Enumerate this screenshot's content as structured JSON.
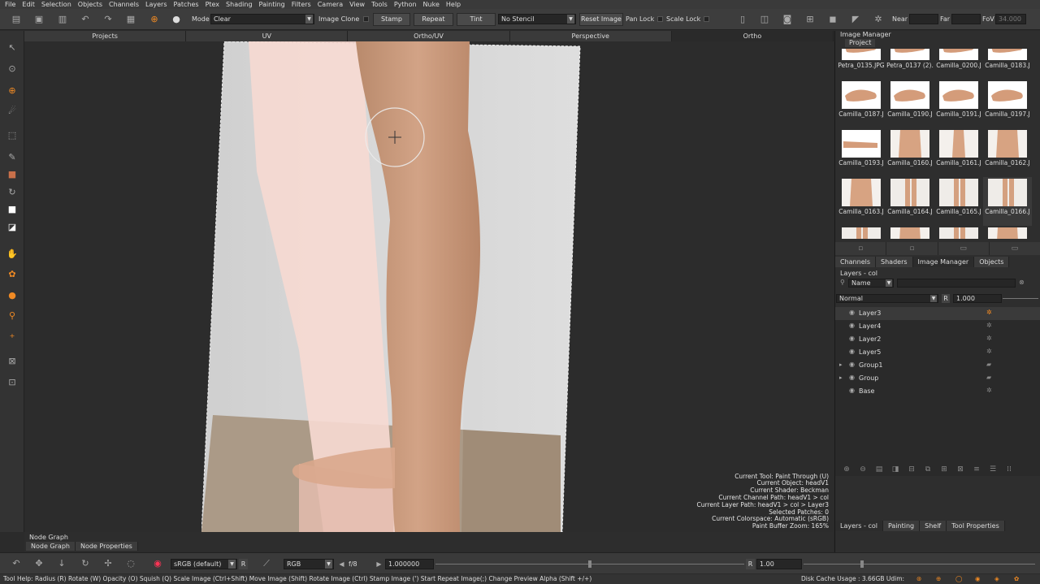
{
  "menu": [
    "File",
    "Edit",
    "Selection",
    "Objects",
    "Channels",
    "Layers",
    "Patches",
    "Ptex",
    "Shading",
    "Painting",
    "Filters",
    "Camera",
    "View",
    "Tools",
    "Python",
    "Nuke",
    "Help"
  ],
  "toolbar": {
    "mode_label": "Mode",
    "mode_value": "Clear",
    "image_clone_label": "Image Clone",
    "stamp_label": "Stamp",
    "repeat_label": "Repeat",
    "tint_label": "Tint",
    "stencil_value": "No Stencil",
    "reset_image_label": "Reset Image",
    "pan_lock_label": "Pan Lock",
    "scale_lock_label": "Scale Lock",
    "near_label": "Near",
    "far_label": "Far",
    "fov_label": "FoV",
    "fov_value": "34.000"
  },
  "viewport_tabs": [
    "Projects",
    "UV",
    "Ortho/UV",
    "Perspective",
    "Ortho"
  ],
  "viewport_info": [
    "Current Tool: Paint Through (U)",
    "Current Object: headV1",
    "Current Shader: Beckman",
    "Current Channel Path: headV1 > col",
    "Current Layer Path: headV1 > col > Layer3",
    "Selected Patches: 0",
    "Current Colorspace: Automatic (sRGB)",
    "Paint Buffer Zoom: 165%"
  ],
  "node_graph": {
    "title": "Node Graph",
    "tabs": [
      "Node Graph",
      "Node Properties"
    ]
  },
  "bottom": {
    "colorspace": "sRGB (default)",
    "r_label": "R",
    "channel": "RGB",
    "fstop": "f/8",
    "exposure": "1.000000",
    "r2_label": "R",
    "gamma": "1.00"
  },
  "status": {
    "help": "Tool Help:   Radius (R)   Rotate (W)   Opacity (O)   Squish (Q)   Scale Image (Ctrl+Shift)   Move Image (Shift)   Rotate Image (Ctrl)   Stamp Image (')   Start Repeat Image(;)   Change Preview Alpha (Shift +/+)",
    "disk": "Disk Cache Usage : 3.66GB  Udim:"
  },
  "image_manager": {
    "title": "Image Manager",
    "tab": "Project",
    "thumbnails": [
      {
        "name": "Petra_0135.JPG",
        "shape": "hand"
      },
      {
        "name": "Petra_0137 (2).",
        "shape": "hand"
      },
      {
        "name": "Camilla_0200.J",
        "shape": "hand"
      },
      {
        "name": "Camilla_0183.J",
        "shape": "hand"
      },
      {
        "name": "Camilla_0187.J",
        "shape": "hand"
      },
      {
        "name": "Camilla_0190.J",
        "shape": "hand"
      },
      {
        "name": "Camilla_0191.J",
        "shape": "hand"
      },
      {
        "name": "Camilla_0197.J",
        "shape": "hand"
      },
      {
        "name": "Camilla_0193.J",
        "shape": "arm"
      },
      {
        "name": "Camilla_0160.J",
        "shape": "torso"
      },
      {
        "name": "Camilla_0161.J",
        "shape": "body"
      },
      {
        "name": "Camilla_0162.J",
        "shape": "torso"
      },
      {
        "name": "Camilla_0163.J",
        "shape": "torso"
      },
      {
        "name": "Camilla_0164.J",
        "shape": "legs"
      },
      {
        "name": "Camilla_0165.J",
        "shape": "legs"
      },
      {
        "name": "Camilla_0166.J",
        "shape": "legs"
      },
      {
        "name": "",
        "shape": "legs"
      },
      {
        "name": "",
        "shape": "torso"
      },
      {
        "name": "",
        "shape": "legs"
      },
      {
        "name": "",
        "shape": "torso"
      }
    ]
  },
  "panel_tabs": [
    "Channels",
    "Shaders",
    "Image Manager",
    "Objects"
  ],
  "layers": {
    "title": "Layers - col",
    "filter": "Name",
    "blend": "Normal",
    "r_label": "R",
    "opacity": "1.000",
    "items": [
      {
        "name": "Layer3",
        "expand": "",
        "icon": "paint-layer",
        "selected": true
      },
      {
        "name": "Layer4",
        "expand": "",
        "icon": "paint-layer",
        "selected": false
      },
      {
        "name": "Layer2",
        "expand": "",
        "icon": "paint-layer",
        "selected": false
      },
      {
        "name": "Layer5",
        "expand": "",
        "icon": "paint-layer",
        "selected": false
      },
      {
        "name": "Group1",
        "expand": "▸",
        "icon": "folder",
        "selected": false
      },
      {
        "name": "Group",
        "expand": "▸",
        "icon": "folder",
        "selected": false
      },
      {
        "name": "Base",
        "expand": "",
        "icon": "paint-layer",
        "selected": false
      }
    ]
  },
  "bottom_panel_tabs": [
    "Layers - col",
    "Painting",
    "Shelf",
    "Tool Properties"
  ]
}
